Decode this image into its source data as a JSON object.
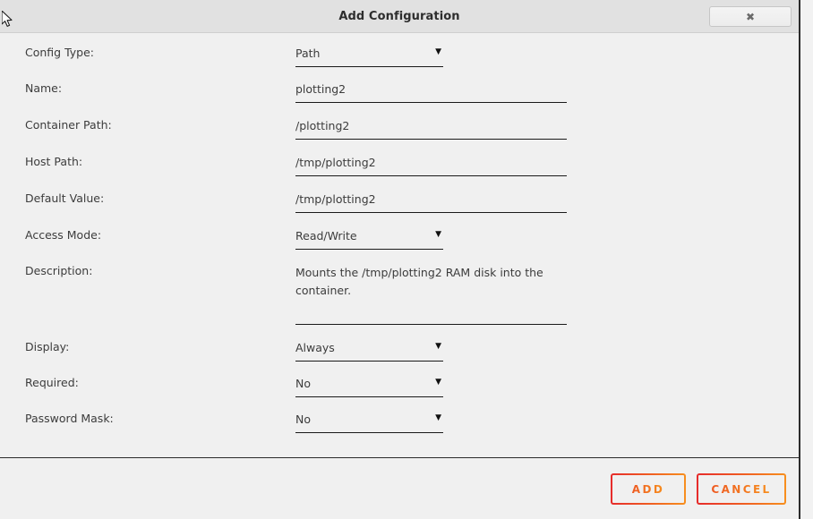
{
  "window": {
    "title": "Add Configuration",
    "close_icon": "close-icon",
    "close_glyph": "✖"
  },
  "form": {
    "fields": [
      {
        "name": "config-type",
        "label": "Config Type:",
        "type": "select",
        "value": "Path",
        "arrow": "▼"
      },
      {
        "name": "name",
        "label": "Name:",
        "type": "text",
        "value": "plotting2"
      },
      {
        "name": "container-path",
        "label": "Container Path:",
        "type": "text",
        "value": "/plotting2"
      },
      {
        "name": "host-path",
        "label": "Host Path:",
        "type": "text",
        "value": "/tmp/plotting2"
      },
      {
        "name": "default-value",
        "label": "Default Value:",
        "type": "text",
        "value": "/tmp/plotting2"
      },
      {
        "name": "access-mode",
        "label": "Access Mode:",
        "type": "select",
        "value": "Read/Write",
        "arrow": "▼"
      },
      {
        "name": "description",
        "label": "Description:",
        "type": "textarea",
        "value": "Mounts the /tmp/plotting2 RAM disk into the container."
      },
      {
        "name": "display",
        "label": "Display:",
        "type": "select",
        "value": "Always",
        "arrow": "▼"
      },
      {
        "name": "required",
        "label": "Required:",
        "type": "select",
        "value": "No",
        "arrow": "▼"
      },
      {
        "name": "password-mask",
        "label": "Password Mask:",
        "type": "select",
        "value": "No",
        "arrow": "▼"
      }
    ]
  },
  "footer": {
    "add_label": "ADD",
    "cancel_label": "CANCEL"
  },
  "colors": {
    "accent_start": "#e62b2b",
    "accent_end": "#f78f1e",
    "titlebar_bg": "#e1e1e1",
    "body_bg": "#f0f0f0",
    "text": "#3c3c3c"
  }
}
